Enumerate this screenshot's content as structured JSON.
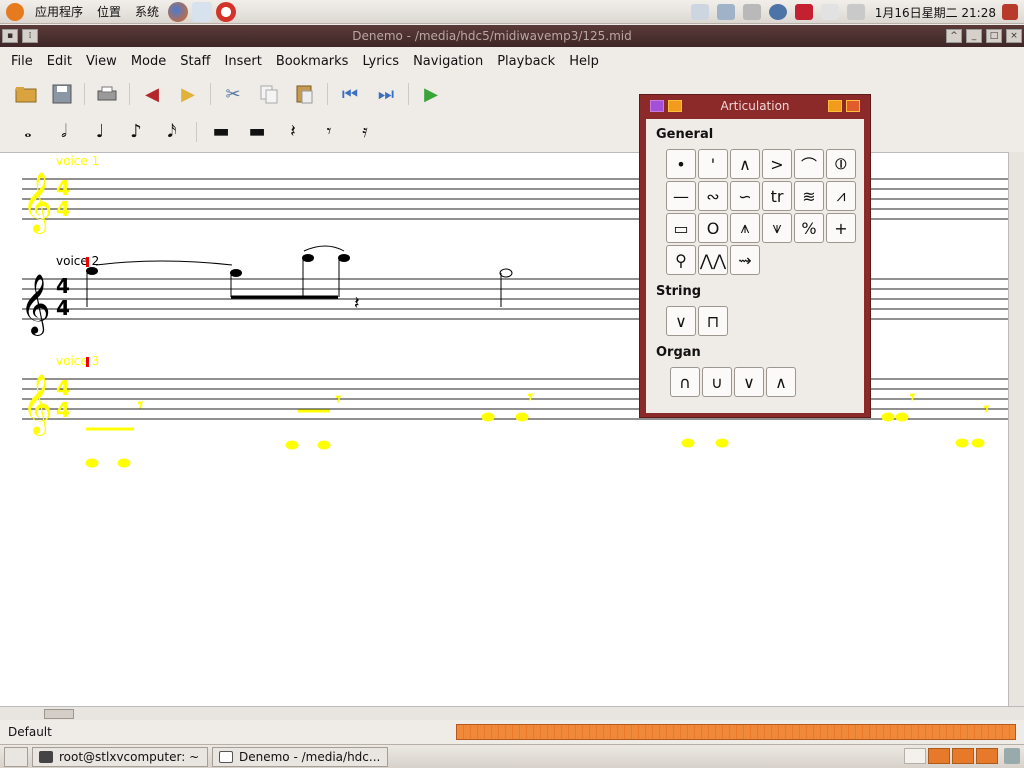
{
  "top_panel": {
    "menus": [
      "应用程序",
      "位置",
      "系统"
    ],
    "clock": "1月16日星期二 21:28"
  },
  "window": {
    "title": "Denemo - /media/hdc5/midiwavemp3/125.mid",
    "menus": [
      "File",
      "Edit",
      "View",
      "Mode",
      "Staff",
      "Insert",
      "Bookmarks",
      "Lyrics",
      "Navigation",
      "Playback",
      "Help"
    ]
  },
  "toolbar": {
    "icons": [
      "open-icon",
      "save-icon",
      "print-icon",
      "undo-icon",
      "redo-icon",
      "cut-icon",
      "copy-icon",
      "paste-icon",
      "previous-measure-icon",
      "next-measure-icon",
      "play-icon"
    ]
  },
  "score": {
    "staves": [
      {
        "label": "voice 1",
        "color": "#ffff00"
      },
      {
        "label": "voice 2",
        "color": "#000000"
      },
      {
        "label": "voice 3",
        "color": "#ffff00"
      }
    ],
    "time_signature": "4/4"
  },
  "articulation": {
    "title": "Articulation",
    "sections": {
      "general": "General",
      "string": "String",
      "organ": "Organ"
    },
    "general_symbols": [
      "•",
      "'",
      "∧",
      ">",
      "⌒",
      "⦶",
      "—",
      "∾",
      "∽",
      "tr",
      "≋",
      "⩘",
      "▭",
      "O",
      "⩚",
      "⩛",
      "%",
      "+",
      "⚲",
      "⋀⋀",
      "⇝"
    ],
    "string_symbols": [
      "∨",
      "⊓"
    ],
    "organ_symbols": [
      "∩",
      "∪",
      "∨",
      "∧"
    ]
  },
  "status": {
    "text": "Default"
  },
  "taskbar": {
    "tasks": [
      "root@stlxvcomputer: ~",
      "Denemo - /media/hdc..."
    ]
  }
}
